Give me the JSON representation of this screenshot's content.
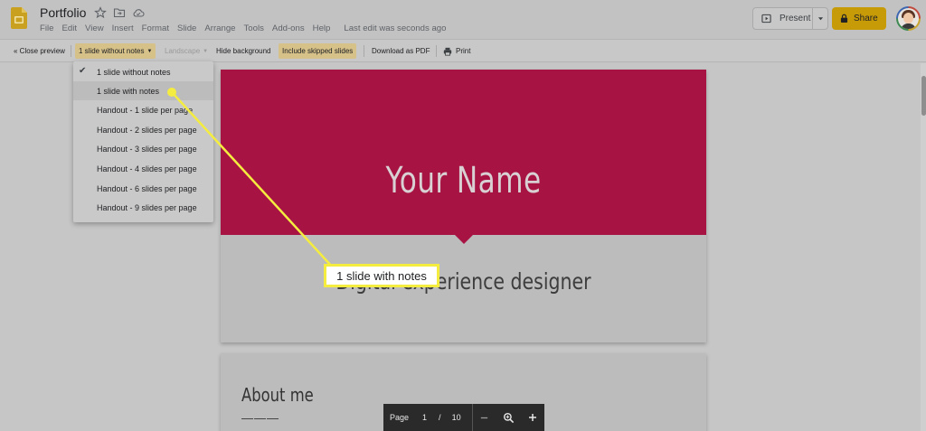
{
  "header": {
    "doc_title": "Portfolio",
    "menu": [
      "File",
      "Edit",
      "View",
      "Insert",
      "Format",
      "Slide",
      "Arrange",
      "Tools",
      "Add-ons",
      "Help"
    ],
    "last_edit": "Last edit was seconds ago",
    "present_label": "Present",
    "share_label": "Share"
  },
  "toolbar": {
    "close_preview": "« Close preview",
    "layout_select": "1 slide without notes",
    "orientation_select": "Landscape",
    "hide_background": "Hide background",
    "include_skipped": "Include skipped slides",
    "download_pdf": "Download as PDF",
    "print": "Print"
  },
  "dropdown": {
    "items": [
      "1 slide without notes",
      "1 slide with notes",
      "Handout - 1 slide per page",
      "Handout - 2 slides per page",
      "Handout - 3 slides per page",
      "Handout - 4 slides per page",
      "Handout - 6 slides per page",
      "Handout - 9 slides per page"
    ],
    "selected": "1 slide without notes",
    "hovered": "1 slide with notes"
  },
  "slides": {
    "slide1_title": "Your Name",
    "slide1_subtitle": "Digital experience designer",
    "slide2_title": "About me",
    "slide2_dashes": "———"
  },
  "callout": {
    "text": "1 slide with notes"
  },
  "pager": {
    "label": "Page",
    "current": "1",
    "separator": "/",
    "total": "10"
  },
  "colors": {
    "title_slide_accent": "#a71444",
    "share_button": "#c79a08",
    "highlight_toolbar": "#d6c189",
    "callout_border": "#f4ec3f"
  }
}
